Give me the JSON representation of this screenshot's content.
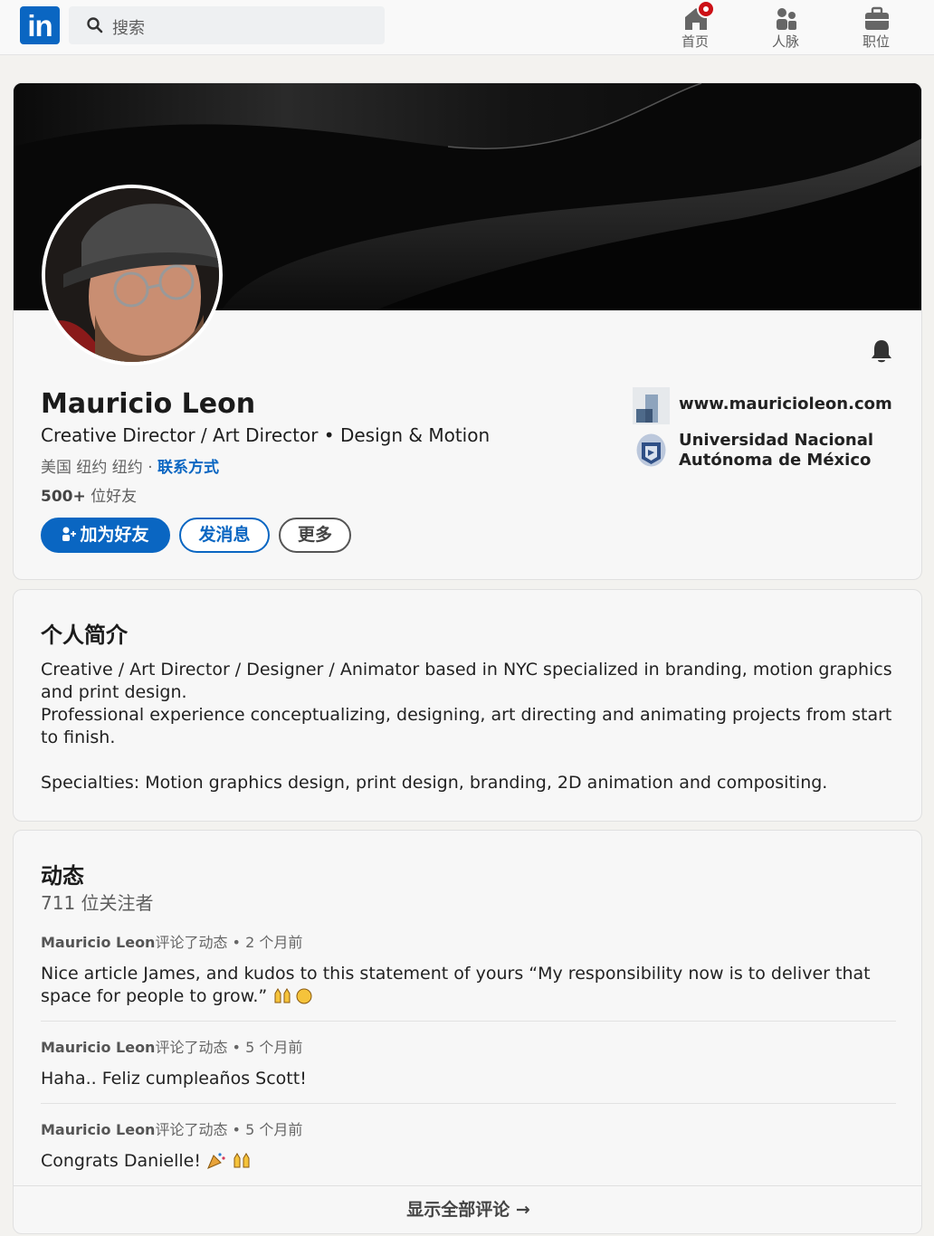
{
  "nav": {
    "search_placeholder": "搜索",
    "items": [
      {
        "label": "首页",
        "icon": "home-icon"
      },
      {
        "label": "人脉",
        "icon": "people-icon"
      },
      {
        "label": "职位",
        "icon": "briefcase-icon"
      }
    ]
  },
  "profile": {
    "name": "Mauricio Leon",
    "headline": "Creative Director / Art Director • Design & Motion",
    "location": "美国 纽约 纽约 · ",
    "contact_label": "联系方式",
    "connections_count": "500+",
    "connections_suffix": " 位好友",
    "buttons": {
      "connect": "加为好友",
      "message": "发消息",
      "more": "更多"
    },
    "website": "www.mauricioleon.com",
    "education": "Universidad Nacional Autónoma de México"
  },
  "about": {
    "title": "个人简介",
    "text": "Creative / Art Director / Designer / Animator based in NYC specialized in branding, motion graphics and print design.\nProfessional experience conceptualizing, designing, art directing and animating projects from start to finish.\n\nSpecialties: Motion graphics design, print design, branding, 2D animation and compositing."
  },
  "activity": {
    "title": "动态",
    "followers": "711 位关注者",
    "posts": [
      {
        "author": "Mauricio Leon",
        "action": "评论了动态 • 2 个月前",
        "body": "Nice article James, and kudos to this statement of yours “My responsibility now is to deliver that space for people to grow.”"
      },
      {
        "author": "Mauricio Leon",
        "action": "评论了动态 • 5 个月前",
        "body": "Haha.. Feliz cumpleaños Scott!"
      },
      {
        "author": "Mauricio Leon",
        "action": "评论了动态 • 5 个月前",
        "body": "Congrats Danielle!"
      }
    ],
    "show_all": "显示全部评论 →"
  },
  "colors": {
    "brand": "#0a66c2",
    "background": "#f3f2ef",
    "notification": "#cc1016"
  }
}
